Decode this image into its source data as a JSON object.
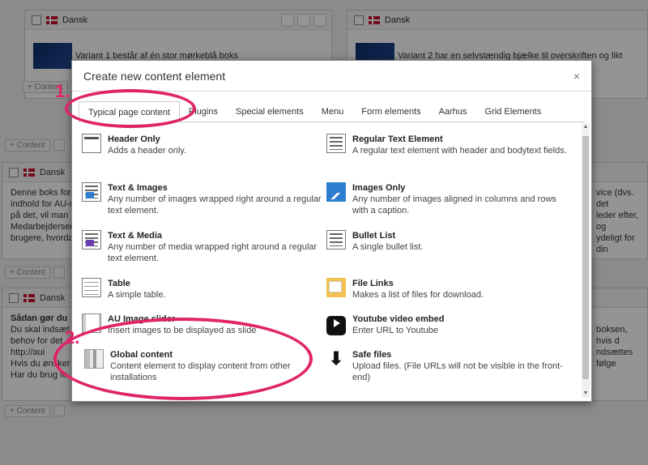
{
  "background": {
    "lang_label": "Dansk",
    "variant1_text": "Variant 1 består af én stor mørkeblå boks",
    "variant2_text": "Variant 2 har en selvstændig bjælke til overskriften og likt",
    "add_content": "+ Content",
    "block2_text": [
      "Denne boks for",
      "indhold for AU-m",
      "på det, vil man",
      "Medarbejderser",
      "brugere, hvorda"
    ],
    "block2_right": [
      "vice (dvs. det",
      "leder efter, og",
      "ydeligt for din"
    ],
    "block3_title": "Sådan gør du",
    "block3_text": [
      "Du skal indsæt",
      "behov for det",
      "http://aui",
      "Hvis du ønsker",
      "Har du brug fo"
    ],
    "block3_right": [
      "boksen, hvis d",
      "ndsættes følge"
    ]
  },
  "modal": {
    "title": "Create new content element",
    "close_glyph": "×",
    "tabs": [
      {
        "label": "Typical page content",
        "active": true
      },
      {
        "label": "Plugins"
      },
      {
        "label": "Special elements"
      },
      {
        "label": "Menu"
      },
      {
        "label": "Form elements"
      },
      {
        "label": "Aarhus"
      },
      {
        "label": "Grid Elements"
      }
    ],
    "items": [
      {
        "name": "Header Only",
        "desc": "Adds a header only.",
        "icon": "header-icon"
      },
      {
        "name": "Regular Text Element",
        "desc": "A regular text element with header and bodytext fields.",
        "icon": "text-icon"
      },
      {
        "name": "Text & Images",
        "desc": "Any number of images wrapped right around a regular text element.",
        "icon": "text-images-icon"
      },
      {
        "name": "Images Only",
        "desc": "Any number of images aligned in columns and rows with a caption.",
        "icon": "images-icon"
      },
      {
        "name": "Text & Media",
        "desc": "Any number of media wrapped right around a regular text element.",
        "icon": "text-media-icon"
      },
      {
        "name": "Bullet List",
        "desc": "A single bullet list.",
        "icon": "bullet-list-icon"
      },
      {
        "name": "Table",
        "desc": "A simple table.",
        "icon": "table-icon"
      },
      {
        "name": "File Links",
        "desc": "Makes a list of files for download.",
        "icon": "file-links-icon"
      },
      {
        "name": "AU Image slider",
        "desc": "Insert images to be displayed as slide",
        "icon": "slider-icon"
      },
      {
        "name": "Youtube video embed",
        "desc": "Enter URL to Youtube",
        "icon": "youtube-icon"
      },
      {
        "name": "Global content",
        "desc": "Content element to display content from other installations",
        "icon": "global-content-icon"
      },
      {
        "name": "Safe files",
        "desc": "Upload files. (File URLs will not be visible in the front-end)",
        "icon": "download-icon"
      }
    ]
  },
  "annotations": {
    "one": "1.",
    "two": "2."
  },
  "colors": {
    "annotation": "#e0246a",
    "overlay": "rgba(0,0,0,0.42)"
  }
}
